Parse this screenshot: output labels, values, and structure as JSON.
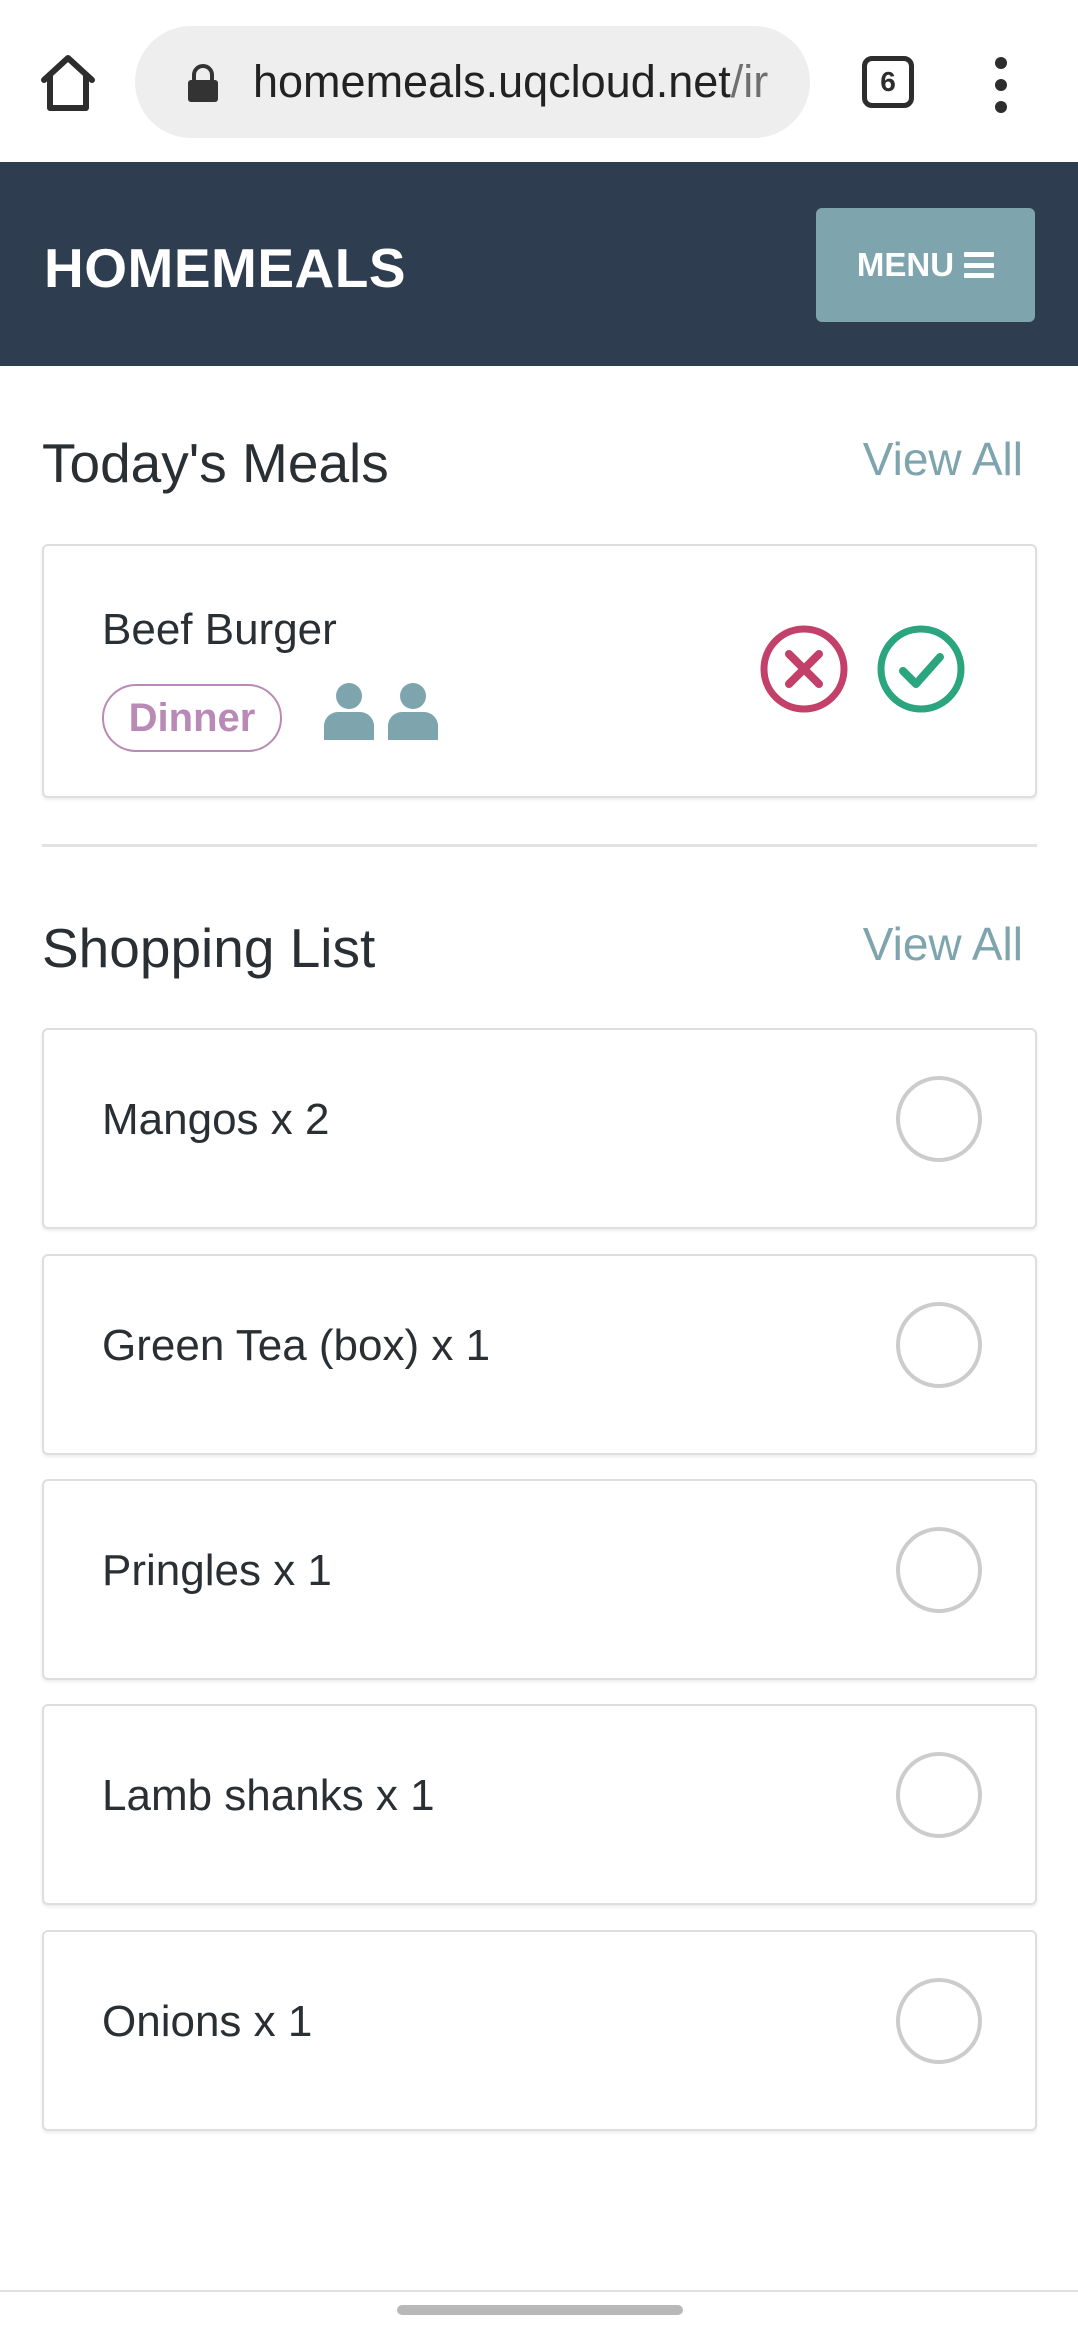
{
  "browser": {
    "url_host": "homemeals.uqcloud.net",
    "url_path": "/ir",
    "tab_count": "6"
  },
  "header": {
    "brand": "HOMEMEALS",
    "menu_label": "MENU"
  },
  "todays_meals": {
    "title": "Today's Meals",
    "view_all": "View All",
    "meals": [
      {
        "name": "Beef Burger",
        "tag": "Dinner",
        "people": 2
      }
    ]
  },
  "shopping_list": {
    "title": "Shopping List",
    "view_all": "View All",
    "items": [
      {
        "label": "Mangos x 2"
      },
      {
        "label": "Green Tea (box) x 1"
      },
      {
        "label": "Pringles x 1"
      },
      {
        "label": "Lamb shanks x 1"
      },
      {
        "label": "Onions x 1"
      }
    ]
  },
  "colors": {
    "header_bg": "#2e3d4f",
    "accent": "#7ea4ae",
    "tag": "#b98ab6",
    "reject": "#c2406a",
    "accept": "#2aa57e"
  },
  "icons": [
    "home-icon",
    "lock-icon",
    "tab-switcher-icon",
    "overflow-menu-icon",
    "hamburger-icon",
    "person-icon",
    "reject-icon",
    "accept-icon",
    "checkbox-circle-icon"
  ]
}
